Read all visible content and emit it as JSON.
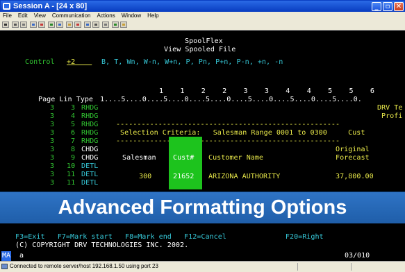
{
  "window": {
    "title": "Session A - [24 x 80]",
    "buttons": [
      "minimize",
      "maximize",
      "close"
    ]
  },
  "menu": [
    "File",
    "Edit",
    "View",
    "Communication",
    "Actions",
    "Window",
    "Help"
  ],
  "terminal": {
    "header_app": "SpoolFlex",
    "header_sub": "View Spooled File",
    "control_label": "Control",
    "control_value": "+2",
    "control_options": "B, T, Wn, W-n, W+n, P, Pn, P+n, P-n, +n, -n",
    "ruler_tens": "1    1    2    2    3    3    4    4    5    5    6",
    "col_header": "Page Lin Type",
    "ruler_marks": "1....5....0....5....0....5....0....5....0....5....0....5....0.",
    "rows": [
      {
        "page": "3",
        "lin": "3",
        "type": "RHDG",
        "text": "DRV Te"
      },
      {
        "page": "3",
        "lin": "4",
        "type": "RHDG",
        "text": "Profi"
      },
      {
        "page": "3",
        "lin": "5",
        "type": "RHDG",
        "text": "-----------------------------------------------------"
      },
      {
        "page": "3",
        "lin": "6",
        "type": "RHDG",
        "text": "Selection Criteria:   Salesman Range 0001 to 0300     Cust"
      },
      {
        "page": "3",
        "lin": "7",
        "type": "RHDG",
        "text": "-----------------------------------------------------"
      },
      {
        "page": "3",
        "lin": "8",
        "type": "CHDG",
        "text": "Original"
      },
      {
        "page": "3",
        "lin": "9",
        "type": "CHDG",
        "text": "Salesman        Customer Name                  Forecast"
      },
      {
        "page": "3",
        "lin": "10",
        "type": "DETL",
        "text": ""
      },
      {
        "page": "3",
        "lin": "11",
        "type": "DETL",
        "text": "300          ARIZONA AUTHORITY              37,800.00"
      },
      {
        "page": "3",
        "lin": "11",
        "type": "DETL",
        "text": ""
      }
    ],
    "highlight_header": "Cust#",
    "highlight_value": "21652",
    "fkeys_line": "F3=Exit   F7=Mark start   F8=Mark end   F12=Cancel              F20=Right",
    "copyright": "(C) COPYRIGHT DRV TECHNOLOGIES INC. 2002."
  },
  "banner": "Advanced Formatting Options",
  "status": {
    "mode": "MA",
    "indicator": "a",
    "cursor": "03/010",
    "connection": "Connected to remote server/host 192.168.1.50 using port 23"
  }
}
